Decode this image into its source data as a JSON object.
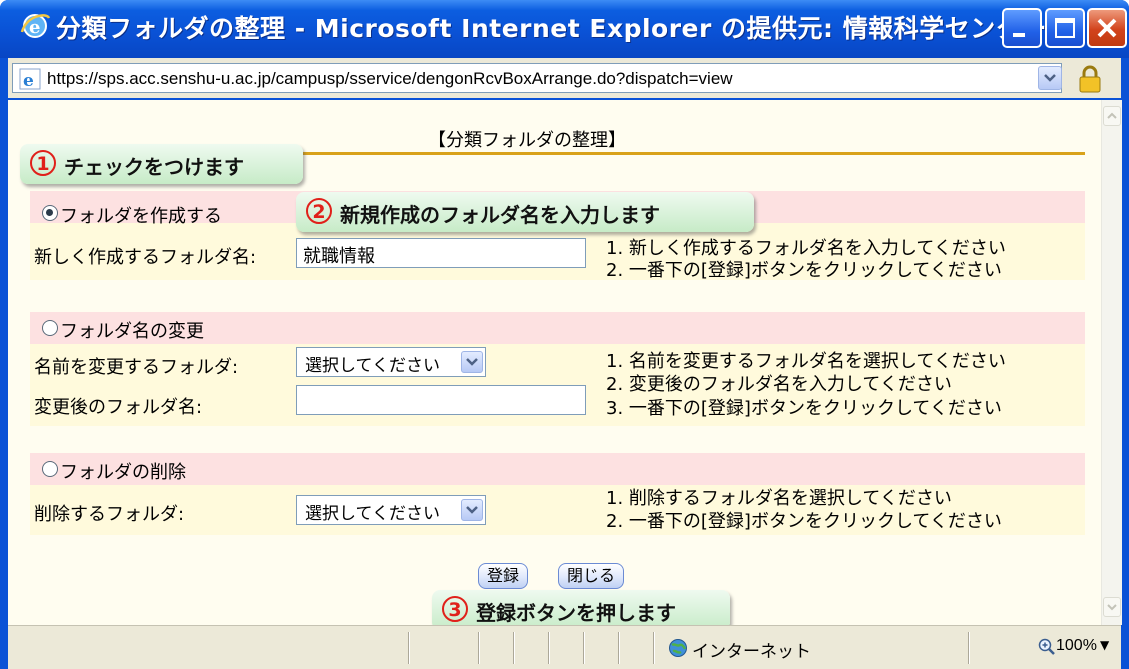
{
  "window": {
    "title": "分類フォルダの整理 - Microsoft Internet Explorer の提供元: 情報科学センター"
  },
  "address": {
    "url": "https://sps.acc.senshu-u.ac.jp/campusp/sservice/dengonRcvBoxArrange.do?dispatch=view"
  },
  "page": {
    "title": "【分類フォルダの整理】"
  },
  "create_section": {
    "radio_label": "フォルダを作成する",
    "selected": true,
    "field_label": "新しく作成するフォルダ名:",
    "field_value": "就職情報",
    "instructions": [
      "1. 新しく作成するフォルダ名を入力してください",
      "2. 一番下の[登録]ボタンをクリックしてください"
    ]
  },
  "rename_section": {
    "radio_label": "フォルダ名の変更",
    "selected": false,
    "select_label": "名前を変更するフォルダ:",
    "select_value": "選択してください",
    "field_label": "変更後のフォルダ名:",
    "field_value": "",
    "instructions": [
      "1. 名前を変更するフォルダ名を選択してください",
      "2. 変更後のフォルダ名を入力してください",
      "3. 一番下の[登録]ボタンをクリックしてください"
    ]
  },
  "delete_section": {
    "radio_label": "フォルダの削除",
    "selected": false,
    "select_label": "削除するフォルダ:",
    "select_value": "選択してください",
    "instructions": [
      "1. 削除するフォルダ名を選択してください",
      "2. 一番下の[登録]ボタンをクリックしてください"
    ]
  },
  "buttons": {
    "register": "登録",
    "close": "閉じる"
  },
  "callouts": [
    {
      "number": "1",
      "text": "チェックをつけます"
    },
    {
      "number": "2",
      "text": "新規作成のフォルダ名を入力します"
    },
    {
      "number": "3",
      "text": "登録ボタンを押します"
    }
  ],
  "status": {
    "zone": "インターネット",
    "zoom": "100%"
  },
  "colors": {
    "titlebar": "#0a52d6",
    "section_header": "#fde1e1",
    "section_body": "#fffadc",
    "rule": "#d9a21a",
    "callout_number": "#e0201a"
  }
}
